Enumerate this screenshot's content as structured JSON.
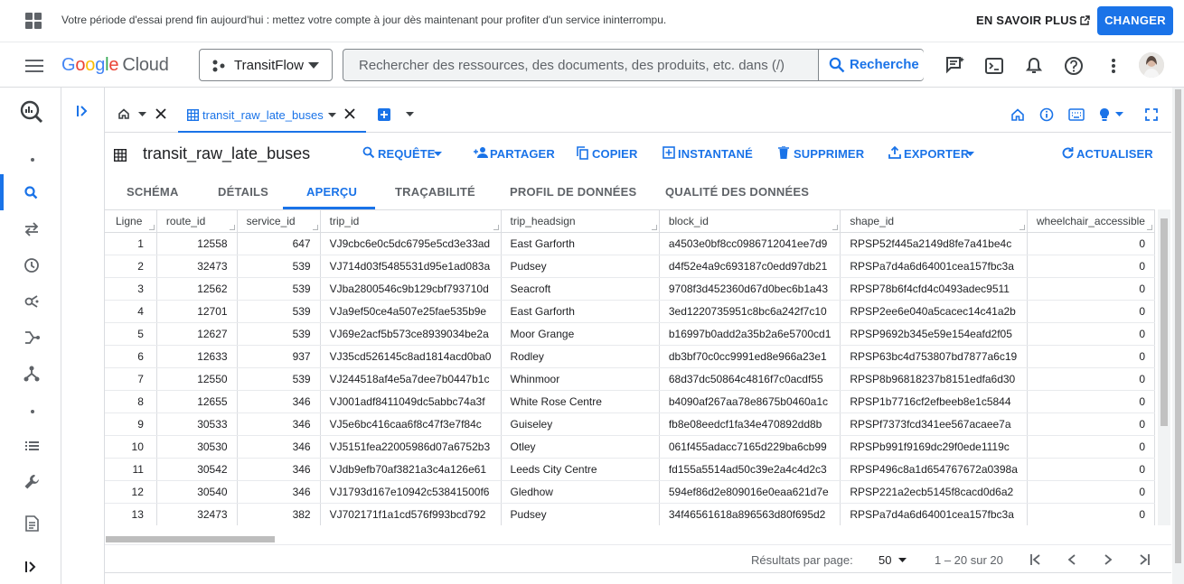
{
  "banner": {
    "message": "Votre période d'essai prend fin aujourd'hui : mettez votre compte à jour dès maintenant pour profiter d'un service ininterrompu.",
    "learn_more": "EN SAVOIR PLUS",
    "change": "CHANGER"
  },
  "header": {
    "logo_letters": [
      "G",
      "o",
      "o",
      "g",
      "l",
      "e"
    ],
    "logo_cloud": "Cloud",
    "project": "TransitFlow",
    "search_placeholder": "Rechercher des ressources, des documents, des produits, etc. dans (/)",
    "search_button": "Recherche"
  },
  "tabs": {
    "active_tab": "transit_raw_late_buses"
  },
  "table_toolbar": {
    "title": "transit_raw_late_buses",
    "actions": [
      "REQUÊTE",
      "PARTAGER",
      "COPIER",
      "INSTANTANÉ",
      "SUPPRIMER",
      "EXPORTER",
      "ACTUALISER"
    ]
  },
  "subtabs": [
    "SCHÉMA",
    "DÉTAILS",
    "APERÇU",
    "TRAÇABILITÉ",
    "PROFIL DE DONNÉES",
    "QUALITÉ DES DONNÉES"
  ],
  "grid": {
    "columns": [
      "Ligne",
      "route_id",
      "service_id",
      "trip_id",
      "trip_headsign",
      "block_id",
      "shape_id",
      "wheelchair_accessible"
    ],
    "rows": [
      [
        "1",
        "12558",
        "647",
        "VJ9cbc6e0c5dc6795e5cd3e33ad",
        "East Garforth",
        "a4503e0bf8cc0986712041ee7d9",
        "RPSP52f445a2149d8fe7a41be4c",
        "0"
      ],
      [
        "2",
        "32473",
        "539",
        "VJ714d03f5485531d95e1ad083a",
        "Pudsey",
        "d4f52e4a9c693187c0edd97db21",
        "RPSPa7d4a6d64001cea157fbc3a",
        "0"
      ],
      [
        "3",
        "12562",
        "539",
        "VJba2800546c9b129cbf793710d",
        "Seacroft",
        "9708f3d452360d67d0bec6b1a43",
        "RPSP78b6f4cfd4c0493adec9511",
        "0"
      ],
      [
        "4",
        "12701",
        "539",
        "VJa9ef50ce4a507e25fae535b9e",
        "East Garforth",
        "3ed1220735951c8bc6a242f7c10",
        "RPSP2ee6e040a5cacec14c41a2b",
        "0"
      ],
      [
        "5",
        "12627",
        "539",
        "VJ69e2acf5b573ce8939034be2a",
        "Moor Grange",
        "b16997b0add2a35b2a6e5700cd1",
        "RPSP9692b345e59e154eafd2f05",
        "0"
      ],
      [
        "6",
        "12633",
        "937",
        "VJ35cd526145c8ad1814acd0ba0",
        "Rodley",
        "db3bf70c0cc9991ed8e966a23e1",
        "RPSP63bc4d753807bd7877a6c19",
        "0"
      ],
      [
        "7",
        "12550",
        "539",
        "VJ244518af4e5a7dee7b0447b1c",
        "Whinmoor",
        "68d37dc50864c4816f7c0acdf55",
        "RPSP8b96818237b8151edfa6d30",
        "0"
      ],
      [
        "8",
        "12655",
        "346",
        "VJ001adf8411049dc5abbc74a3f",
        "White Rose Centre",
        "b4090af267aa78e8675b0460a1c",
        "RPSP1b7716cf2efbeeb8e1c5844",
        "0"
      ],
      [
        "9",
        "30533",
        "346",
        "VJ5e6bc416caa6f8c47f3e7f84c",
        "Guiseley",
        "fb8e08eedcf1fa34e470892dd8b",
        "RPSPf7373fcd341ee567acaee7a",
        "0"
      ],
      [
        "10",
        "30530",
        "346",
        "VJ5151fea22005986d07a6752b3",
        "Otley",
        "061f455adacc7165d229ba6cb99",
        "RPSPb991f9169dc29f0ede1119c",
        "0"
      ],
      [
        "11",
        "30542",
        "346",
        "VJdb9efb70af3821a3c4a126e61",
        "Leeds City Centre",
        "fd155a5514ad50c39e2a4c4d2c3",
        "RPSP496c8a1d654767672a0398a",
        "0"
      ],
      [
        "12",
        "30540",
        "346",
        "VJ1793d167e10942c53841500f6",
        "Gledhow",
        "594ef86d2e809016e0eaa621d7e",
        "RPSP221a2ecb5145f8cacd0d6a2",
        "0"
      ],
      [
        "13",
        "32473",
        "382",
        "VJ702171f1a1cd576f993bcd792",
        "Pudsey",
        "34f46561618a896563d80f695d2",
        "RPSPa7d4a6d64001cea157fbc3a",
        "0"
      ]
    ]
  },
  "pagination": {
    "label": "Résultats par page:",
    "per_page": "50",
    "range": "1 – 20 sur 20"
  },
  "colors": {
    "accent": "#1a73e8"
  }
}
